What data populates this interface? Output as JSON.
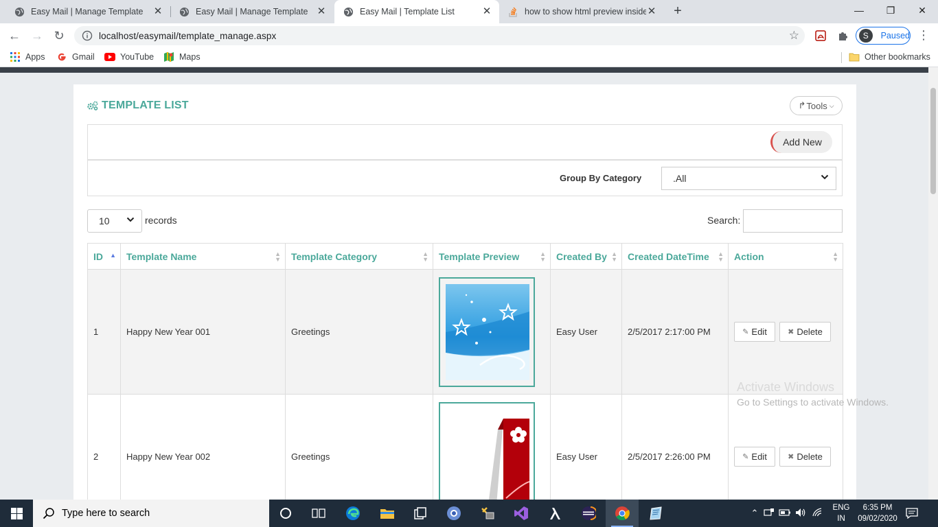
{
  "browser": {
    "tabs": [
      {
        "title": "Easy Mail | Manage Template",
        "icon": "globe-icon",
        "active": false
      },
      {
        "title": "Easy Mail | Manage Template",
        "icon": "globe-icon",
        "active": false
      },
      {
        "title": "Easy Mail | Template List",
        "icon": "globe-icon",
        "active": true
      },
      {
        "title": "how to show html preview inside",
        "icon": "stackoverflow-icon",
        "active": false
      }
    ],
    "url": "localhost/easymail/template_manage.aspx",
    "profile_initial": "S",
    "profile_status": "Paused",
    "bookmarks": [
      "Apps",
      "Gmail",
      "YouTube",
      "Maps"
    ],
    "other_bookmarks": "Other bookmarks"
  },
  "page": {
    "title": "TEMPLATE LIST",
    "tools_label": "Tools",
    "add_new_label": "Add New",
    "group_by_label": "Group By Category",
    "group_by_value": ".All",
    "length_value": "10",
    "records_label": "records",
    "search_label": "Search:",
    "search_value": "",
    "columns": [
      "ID",
      "Template Name",
      "Template Category",
      "Template Preview",
      "Created By",
      "Created DateTime",
      "Action"
    ],
    "rows": [
      {
        "id": "1",
        "name": "Happy New Year 001",
        "category": "Greetings",
        "preview": "blue stars greeting card",
        "created_by": "Easy User",
        "created": "2/5/2017 2:17:00 PM"
      },
      {
        "id": "2",
        "name": "Happy New Year 002",
        "category": "Greetings",
        "preview": "red flower greeting card",
        "created_by": "Easy User",
        "created": "2/5/2017 2:26:00 PM"
      }
    ],
    "edit_label": "Edit",
    "delete_label": "Delete"
  },
  "watermark": {
    "line1": "Activate Windows",
    "line2": "Go to Settings to activate Windows."
  },
  "taskbar": {
    "search_placeholder": "Type here to search",
    "lang_top": "ENG",
    "lang_bottom": "IN",
    "time": "6:35 PM",
    "date": "09/02/2020"
  },
  "colors": {
    "accent": "#4aa89a",
    "sort_active": "#5b7be0",
    "taskbar": "#1f2c3a",
    "profile_blue": "#1a73e8"
  }
}
